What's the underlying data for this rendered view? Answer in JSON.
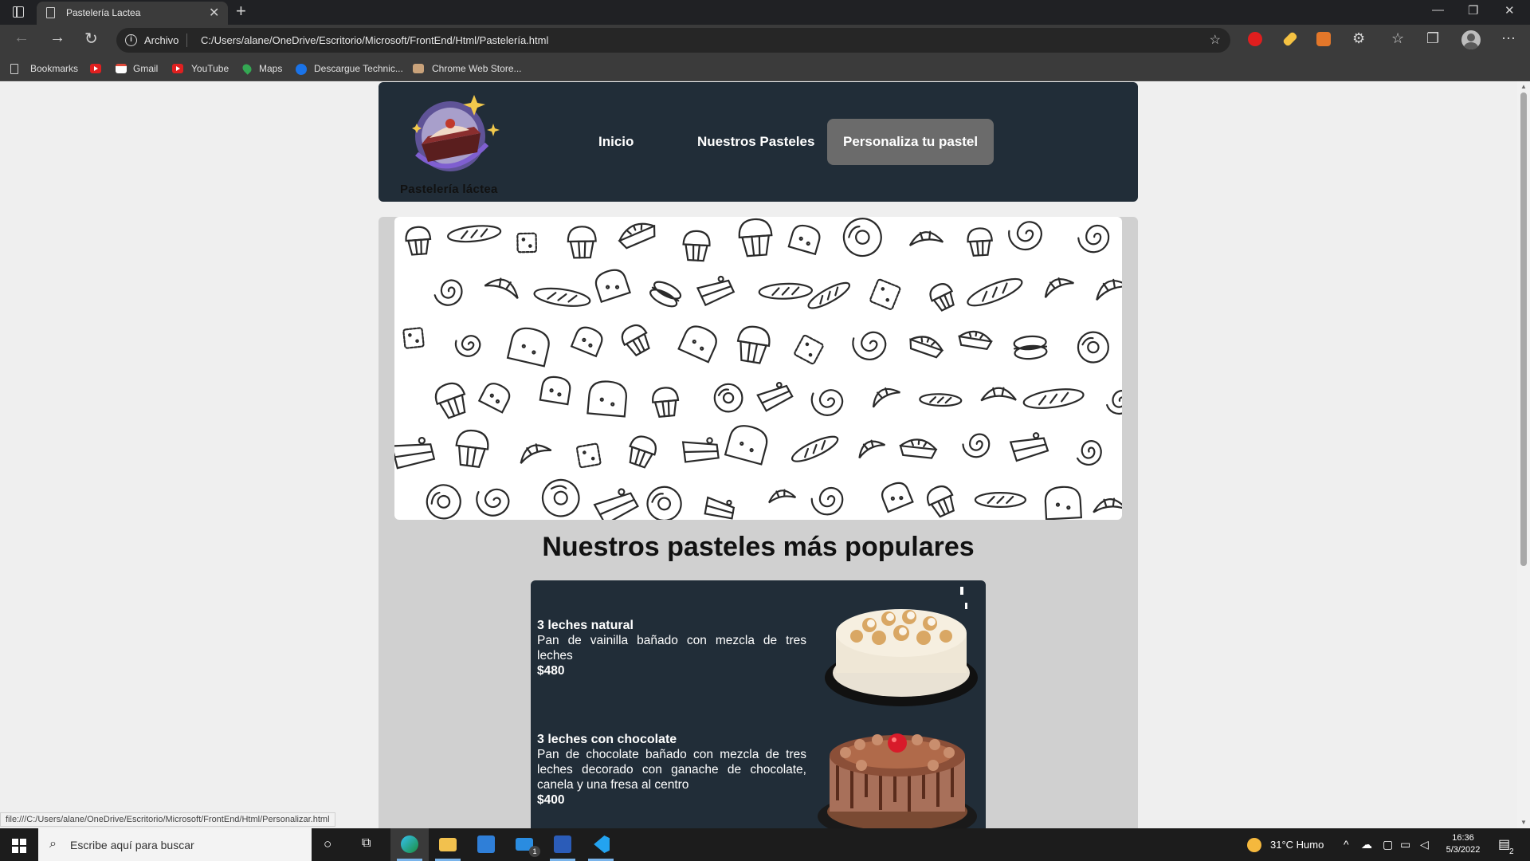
{
  "browser": {
    "tab_title": "Pastelería Lactea",
    "tab_close": "✕",
    "new_tab": "+",
    "controls": {
      "minimize": "—",
      "restore": "❐",
      "close": "✕"
    },
    "site_info_label": "Archivo",
    "url": "C:/Users/alane/OneDrive/Escritorio/Microsoft/FrontEnd/Html/Pastelería.html",
    "bookmarks": [
      {
        "label": "Bookmarks",
        "icon": "bookmark-icon"
      },
      {
        "label": "",
        "icon": "youtube-icon"
      },
      {
        "label": "Gmail",
        "icon": "gmail-icon"
      },
      {
        "label": "YouTube",
        "icon": "youtube-icon"
      },
      {
        "label": "Maps",
        "icon": "maps-icon"
      },
      {
        "label": "Descargue Technic...",
        "icon": "globe-icon"
      },
      {
        "label": "Chrome Web Store...",
        "icon": "webstore-icon"
      }
    ],
    "status_url": "file:///C:/Users/alane/OneDrive/Escritorio/Microsoft/FrontEnd/Html/Personalizar.html"
  },
  "site": {
    "brand": "Pastelería láctea",
    "nav": [
      {
        "label": "Inicio",
        "active": false
      },
      {
        "label": "Nuestros Pasteles",
        "active": false
      },
      {
        "label": "Personaliza tu pastel",
        "active": true
      }
    ],
    "section_title": "Nuestros pasteles más populares",
    "cakes": [
      {
        "name": "3 leches natural",
        "description": "Pan de vainilla bañado con mezcla de tres leches",
        "price": "$480"
      },
      {
        "name": "3 leches con chocolate",
        "description": "Pan de chocolate bañado con mezcla de tres leches decorado con ganache de chocolate, canela y una fresa al centro",
        "price": "$400"
      }
    ]
  },
  "taskbar": {
    "search_placeholder": "Escribe aquí para buscar",
    "weather": "31°C  Humo",
    "time": "16:36",
    "date": "5/3/2022",
    "notification_count": "2",
    "mail_badge": "1"
  },
  "colors": {
    "header_bg": "#212d38",
    "panel_bg": "#d0d0d0",
    "page_bg": "#efefef",
    "active_nav": "#6b6b6b"
  }
}
